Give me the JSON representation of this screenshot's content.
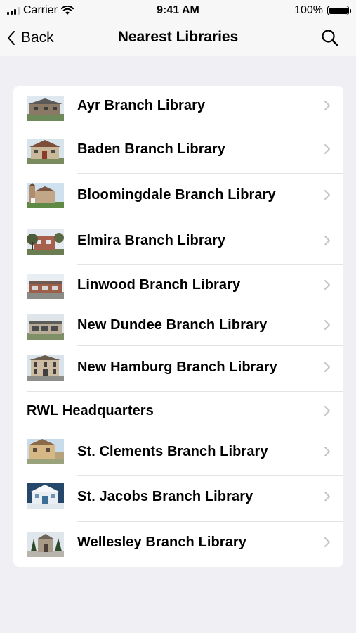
{
  "status_bar": {
    "carrier": "Carrier",
    "time": "9:41 AM",
    "battery": "100%"
  },
  "nav": {
    "back_label": "Back",
    "title": "Nearest Libraries"
  },
  "libraries": [
    {
      "label": "Ayr Branch Library",
      "has_thumbnail": true
    },
    {
      "label": "Baden Branch Library",
      "has_thumbnail": true
    },
    {
      "label": "Bloomingdale Branch Library",
      "has_thumbnail": true
    },
    {
      "label": "Elmira Branch Library",
      "has_thumbnail": true
    },
    {
      "label": "Linwood Branch Library",
      "has_thumbnail": true
    },
    {
      "label": "New Dundee Branch Library",
      "has_thumbnail": true
    },
    {
      "label": "New Hamburg Branch Library",
      "has_thumbnail": true
    },
    {
      "label": "RWL Headquarters",
      "has_thumbnail": false
    },
    {
      "label": "St. Clements Branch Library",
      "has_thumbnail": true
    },
    {
      "label": "St. Jacobs Branch Library",
      "has_thumbnail": true
    },
    {
      "label": "Wellesley Branch Library",
      "has_thumbnail": true
    }
  ],
  "colors": {
    "background": "#efeff4",
    "nav_background": "#f7f7f7",
    "chevron": "#c4c4c7",
    "separator": "#e3e3e6"
  }
}
